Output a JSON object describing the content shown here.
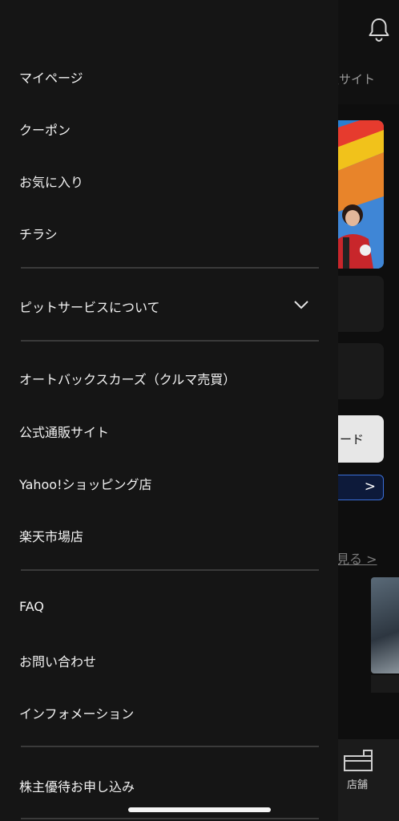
{
  "background": {
    "partial_tab_label": "販サイト",
    "light_button_label": "ード",
    "blue_button_chevron": ">",
    "more_link": "見る >",
    "tabbar_store_label": "店舗"
  },
  "menu": {
    "items_group1": [
      {
        "label": "マイページ"
      },
      {
        "label": "クーポン"
      },
      {
        "label": "お気に入り"
      },
      {
        "label": "チラシ"
      }
    ],
    "pit_service": {
      "label": "ピットサービスについて"
    },
    "items_group2": [
      {
        "label": "オートバックスカーズ（クルマ売買）"
      },
      {
        "label": "公式通販サイト"
      },
      {
        "label": "Yahoo!ショッピング店"
      },
      {
        "label": "楽天市場店"
      }
    ],
    "items_group3": [
      {
        "label": "FAQ"
      },
      {
        "label": "お問い合わせ"
      },
      {
        "label": "インフォメーション"
      }
    ],
    "items_group4": [
      {
        "label": "株主優待お申し込み"
      }
    ]
  },
  "colors": {
    "drawer_bg": "#151515",
    "divider": "#3a3a3a",
    "text": "#f2f2f2",
    "accent_blue": "#3a6fd8"
  },
  "icons": {
    "bell": "bell-icon",
    "chevron": "chevron-down-icon",
    "store": "store-icon"
  }
}
